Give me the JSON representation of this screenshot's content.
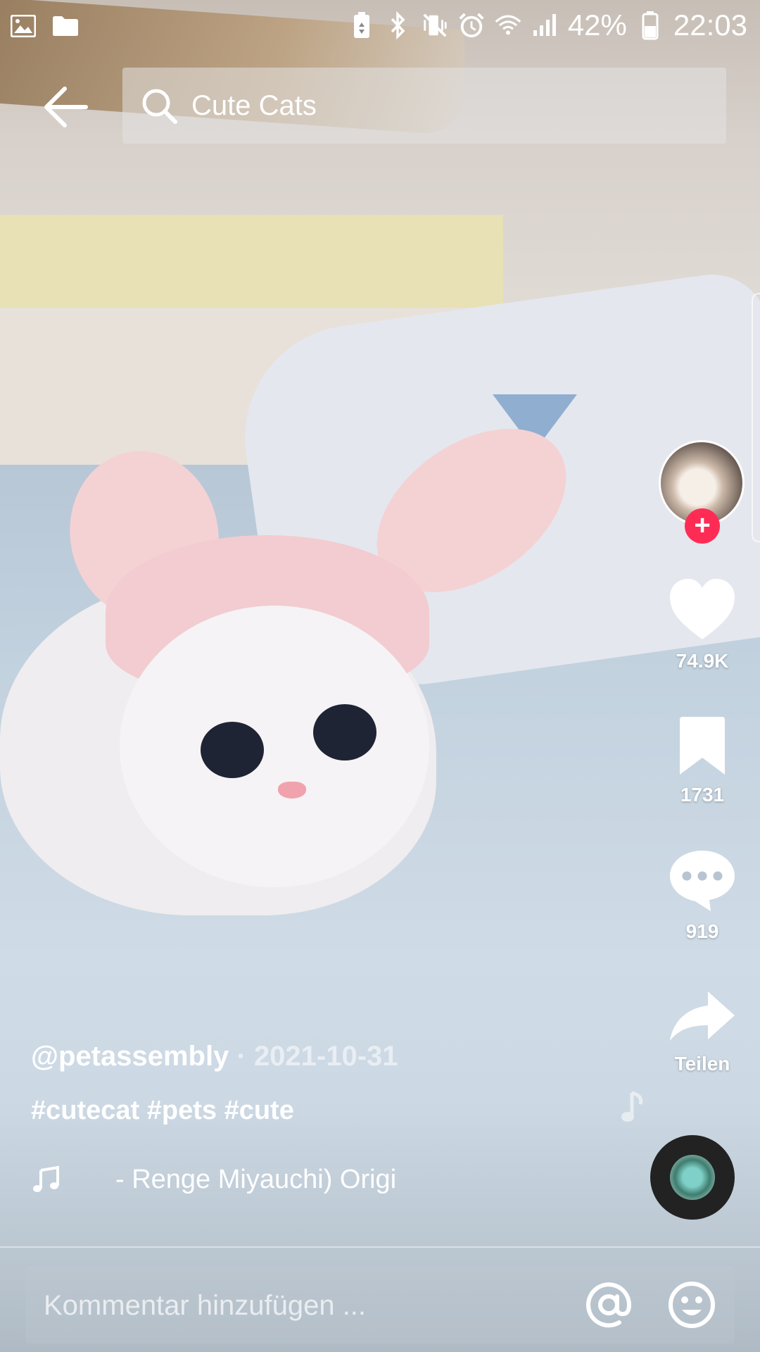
{
  "status_bar": {
    "battery": "42%",
    "time": "22:03"
  },
  "search": {
    "query": "Cute Cats"
  },
  "video": {
    "author": "@petassembly",
    "separator": "·",
    "date": "2021-10-31",
    "hashtags": "#cutecat #pets #cute",
    "sound": "- Renge Miyauchi)    Origi"
  },
  "actions": {
    "likes": "74.9K",
    "favorites": "1731",
    "comments": "919",
    "share_label": "Teilen"
  },
  "comment_bar": {
    "placeholder": "Kommentar hinzufügen ..."
  },
  "colors": {
    "follow_badge": "#fe2c55"
  }
}
